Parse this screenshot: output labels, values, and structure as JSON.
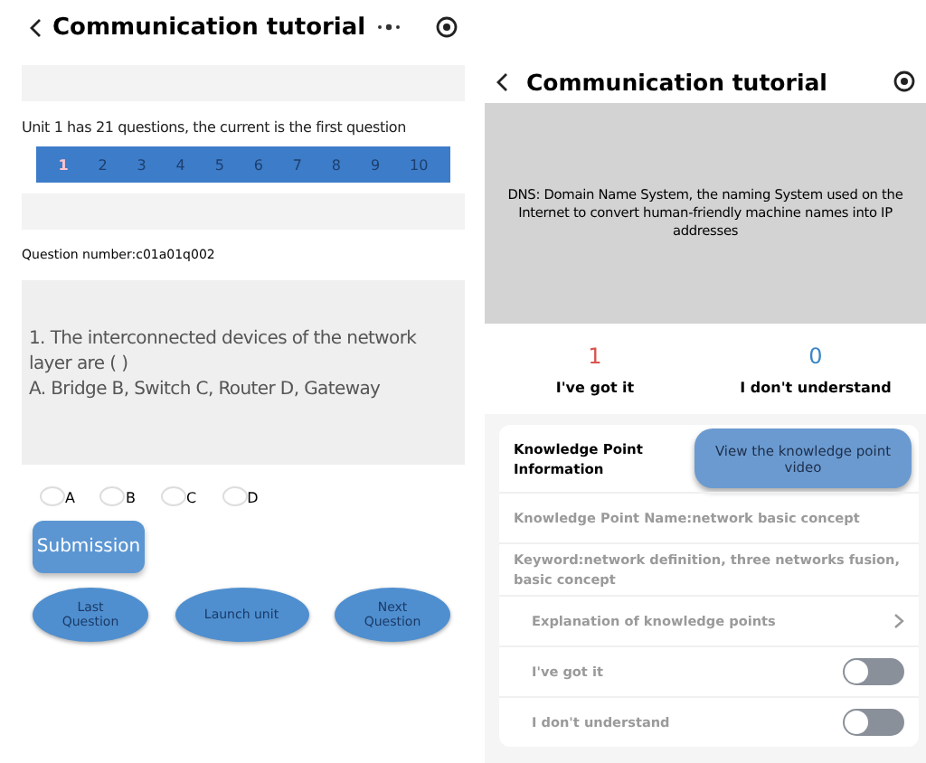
{
  "quiz_screen": {
    "title": "Communication tutorial",
    "unit_info": "Unit 1 has 21 questions, the current is the first question",
    "question_numbers": [
      {
        "label": "1",
        "selected": true
      },
      {
        "label": "2",
        "selected": false
      },
      {
        "label": "3",
        "selected": false
      },
      {
        "label": "4",
        "selected": false
      },
      {
        "label": "5",
        "selected": false
      },
      {
        "label": "6",
        "selected": false
      },
      {
        "label": "7",
        "selected": false
      },
      {
        "label": "8",
        "selected": false
      },
      {
        "label": "9",
        "selected": false
      },
      {
        "label": "10",
        "selected": false
      }
    ],
    "question_number": "Question number:c01a01q002",
    "question_lines": [
      "1. The interconnected devices of the network",
      "layer are ( )",
      "A. Bridge B, Switch C, Router D, Gateway"
    ],
    "options": [
      {
        "label": "A",
        "selected": false
      },
      {
        "label": "B",
        "selected": false
      },
      {
        "label": "C",
        "selected": false
      },
      {
        "label": "D",
        "selected": false
      }
    ],
    "submit_button": "Submission",
    "nav_buttons": [
      "Last Question",
      "Launch unit",
      "Next Question"
    ]
  },
  "knowledge_screen": {
    "title": "Communication tutorial",
    "definition": "DNS: Domain Name System, the naming System used on the Internet to convert human-friendly machine names into IP addresses",
    "counts": [
      {
        "value": "1",
        "label": "I've got it",
        "color": "#d9534f"
      },
      {
        "value": "0",
        "label": "I don't understand",
        "color": "#3a86c8"
      }
    ],
    "card": {
      "title": "Knowledge Point Information",
      "video_button": "View the knowledge point video",
      "name": "Knowledge Point Name:network basic concept",
      "keyword": "Keyword:network definition, three networks fusion, basic concept",
      "explanation": "Explanation of knowledge points",
      "toggles": [
        {
          "label": "I've got it",
          "on": false
        },
        {
          "label": "I don't understand",
          "on": false
        }
      ]
    }
  }
}
